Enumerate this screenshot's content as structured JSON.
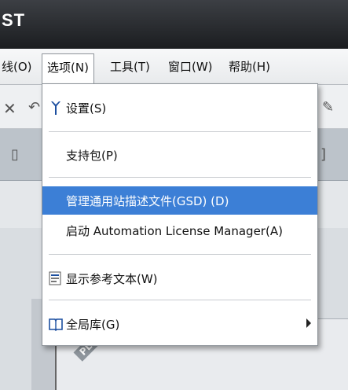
{
  "window": {
    "title": "ST"
  },
  "menubar": {
    "items": [
      {
        "label": "线(O)"
      },
      {
        "label": "选项(N)"
      },
      {
        "label": "工具(T)"
      },
      {
        "label": "窗口(W)"
      },
      {
        "label": "帮助(H)"
      }
    ]
  },
  "background": {
    "plc_label": "PL"
  },
  "options_menu": {
    "items": [
      {
        "label": "设置(S)",
        "icon": "wrench-icon"
      },
      {
        "label": "支持包(P)"
      },
      {
        "label": "管理通用站描述文件(GSD) (D)",
        "highlighted": true
      },
      {
        "label": "启动 Automation License Manager(A)"
      },
      {
        "label": "显示参考文本(W)",
        "icon": "reference-text-icon"
      },
      {
        "label": "全局库(G)",
        "icon": "book-icon",
        "has_submenu": true
      }
    ]
  },
  "colors": {
    "highlight": "#3c7fd6",
    "titlebar": "#1b1d20"
  }
}
